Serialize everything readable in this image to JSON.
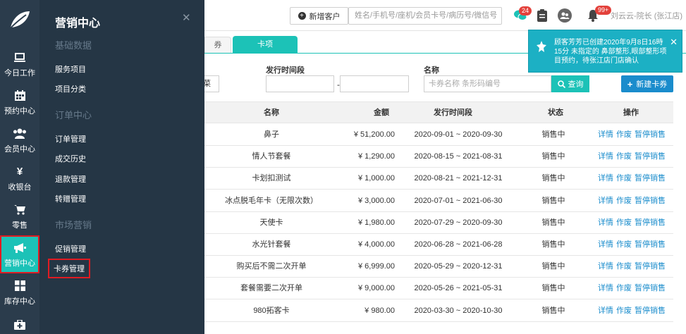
{
  "rail": {
    "items": [
      {
        "label": "今日工作"
      },
      {
        "label": "预约中心"
      },
      {
        "label": "会员中心"
      },
      {
        "label": "收银台"
      },
      {
        "label": "零售"
      },
      {
        "label": "营销中心"
      },
      {
        "label": "库存中心"
      }
    ]
  },
  "flyout": {
    "title": "营销中心",
    "groups": [
      "基础数据",
      "订单中心",
      "市场营销"
    ],
    "items": [
      "服务项目",
      "项目分类",
      "订单管理",
      "成交历史",
      "退款管理",
      "转赠管理",
      "促销管理",
      "卡券管理"
    ]
  },
  "header": {
    "new_customer": "新增客户",
    "search_placeholder": "姓名/手机号/座机/会员卡号/病历号/微信号",
    "badge_msg": "24",
    "badge_notify": "99+",
    "user": "刘云云-院长 (张江店)"
  },
  "tabs": [
    "券",
    "卡项"
  ],
  "filters": {
    "left_btn": "菜",
    "period_label": "发行时间段",
    "name_label": "名称",
    "name_placeholder": "卡券名称 条形码编号",
    "dash": "-",
    "query": "查询",
    "create": "新建卡券"
  },
  "table": {
    "headers": [
      "名称",
      "金额",
      "发行时间段",
      "状态",
      "操作"
    ],
    "rows": [
      {
        "name": "鼻子",
        "amount": "¥ 51,200.00",
        "period": "2020-09-01 ~ 2020-09-30",
        "status": "销售中"
      },
      {
        "name": "情人节套餐",
        "amount": "¥ 1,290.00",
        "period": "2020-08-15 ~ 2021-08-31",
        "status": "销售中"
      },
      {
        "name": "卡划扣测试",
        "amount": "¥ 1,000.00",
        "period": "2020-08-21 ~ 2021-12-31",
        "status": "销售中"
      },
      {
        "name": "冰点脱毛年卡（无限次数）",
        "amount": "¥ 3,000.00",
        "period": "2020-07-01 ~ 2021-06-30",
        "status": "销售中"
      },
      {
        "name": "天使卡",
        "amount": "¥ 1,980.00",
        "period": "2020-07-29 ~ 2020-09-30",
        "status": "销售中"
      },
      {
        "name": "水光针套餐",
        "amount": "¥ 4,000.00",
        "period": "2020-06-28 ~ 2021-06-28",
        "status": "销售中"
      },
      {
        "name": "购买后不需二次开单",
        "amount": "¥ 6,999.00",
        "period": "2020-05-29 ~ 2020-12-31",
        "status": "销售中"
      },
      {
        "name": "套餐需要二次开单",
        "amount": "¥ 9,000.00",
        "period": "2020-05-26 ~ 2021-05-31",
        "status": "销售中"
      },
      {
        "name": "980拓客卡",
        "amount": "¥ 980.00",
        "period": "2020-03-30 ~ 2020-10-30",
        "status": "销售中"
      }
    ],
    "ops": [
      "详情",
      "作废",
      "暂停销售"
    ]
  },
  "toast": {
    "text": "顾客芳芳已创建2020年9月8日16時15分 未指定的 鼻部整形,眼部整形项目预约，待张江店门店确认"
  },
  "colors": {
    "teal": "#1cc2b7",
    "blue": "#1a8ccc",
    "dark": "#2b3c4c",
    "red": "#e11b22"
  }
}
